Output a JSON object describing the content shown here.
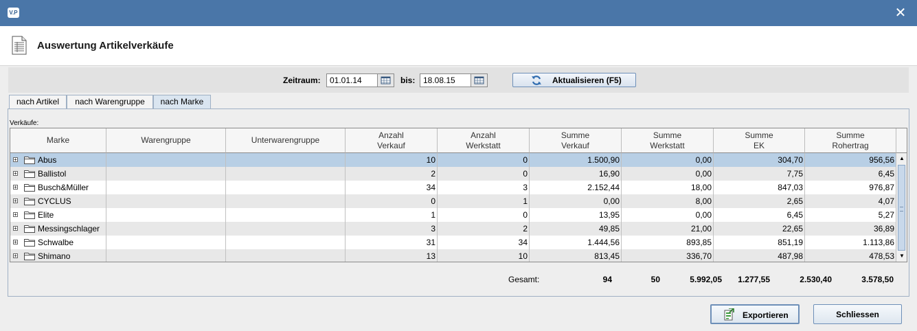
{
  "window": {
    "app_icon_text": "V.P"
  },
  "header": {
    "title": "Auswertung Artikelverkäufe"
  },
  "filter": {
    "zeitraum_label": "Zeitraum:",
    "from_value": "01.01.14",
    "bis_label": "bis:",
    "to_value": "18.08.15",
    "refresh_label": "Aktualisieren (F5)"
  },
  "tabs": [
    {
      "label": "nach Artikel",
      "active": false
    },
    {
      "label": "nach Warengruppe",
      "active": false
    },
    {
      "label": "nach Marke",
      "active": true
    }
  ],
  "section_label": "Verkäufe:",
  "table": {
    "columns": [
      "Marke",
      "Warengruppe",
      "Unterwarengruppe",
      "Anzahl\nVerkauf",
      "Anzahl\nWerkstatt",
      "Summe\nVerkauf",
      "Summe\nWerkstatt",
      "Summe\nEK",
      "Summe\nRohertrag"
    ],
    "rows": [
      {
        "marke": "Abus",
        "warengruppe": "",
        "unterwarengruppe": "",
        "anz_verkauf": "10",
        "anz_werkstatt": "0",
        "sum_verkauf": "1.500,90",
        "sum_werkstatt": "0,00",
        "sum_ek": "304,70",
        "sum_rohertrag": "956,56",
        "selected": true
      },
      {
        "marke": "Ballistol",
        "warengruppe": "",
        "unterwarengruppe": "",
        "anz_verkauf": "2",
        "anz_werkstatt": "0",
        "sum_verkauf": "16,90",
        "sum_werkstatt": "0,00",
        "sum_ek": "7,75",
        "sum_rohertrag": "6,45",
        "selected": false
      },
      {
        "marke": "Busch&Müller",
        "warengruppe": "",
        "unterwarengruppe": "",
        "anz_verkauf": "34",
        "anz_werkstatt": "3",
        "sum_verkauf": "2.152,44",
        "sum_werkstatt": "18,00",
        "sum_ek": "847,03",
        "sum_rohertrag": "976,87",
        "selected": false
      },
      {
        "marke": "CYCLUS",
        "warengruppe": "",
        "unterwarengruppe": "",
        "anz_verkauf": "0",
        "anz_werkstatt": "1",
        "sum_verkauf": "0,00",
        "sum_werkstatt": "8,00",
        "sum_ek": "2,65",
        "sum_rohertrag": "4,07",
        "selected": false
      },
      {
        "marke": "Elite",
        "warengruppe": "",
        "unterwarengruppe": "",
        "anz_verkauf": "1",
        "anz_werkstatt": "0",
        "sum_verkauf": "13,95",
        "sum_werkstatt": "0,00",
        "sum_ek": "6,45",
        "sum_rohertrag": "5,27",
        "selected": false
      },
      {
        "marke": "Messingschlager",
        "warengruppe": "",
        "unterwarengruppe": "",
        "anz_verkauf": "3",
        "anz_werkstatt": "2",
        "sum_verkauf": "49,85",
        "sum_werkstatt": "21,00",
        "sum_ek": "22,65",
        "sum_rohertrag": "36,89",
        "selected": false
      },
      {
        "marke": "Schwalbe",
        "warengruppe": "",
        "unterwarengruppe": "",
        "anz_verkauf": "31",
        "anz_werkstatt": "34",
        "sum_verkauf": "1.444,56",
        "sum_werkstatt": "893,85",
        "sum_ek": "851,19",
        "sum_rohertrag": "1.113,86",
        "selected": false
      },
      {
        "marke": "Shimano",
        "warengruppe": "",
        "unterwarengruppe": "",
        "anz_verkauf": "13",
        "anz_werkstatt": "10",
        "sum_verkauf": "813,45",
        "sum_werkstatt": "336,70",
        "sum_ek": "487,98",
        "sum_rohertrag": "478,53",
        "selected": false
      }
    ]
  },
  "totals": {
    "label": "Gesamt:",
    "anz_verkauf": "94",
    "anz_werkstatt": "50",
    "sum_verkauf": "5.992,05",
    "sum_werkstatt": "1.277,55",
    "sum_ek": "2.530,40",
    "sum_rohertrag": "3.578,50"
  },
  "buttons": {
    "export_label": "Exportieren",
    "close_label": "Schliessen"
  },
  "icons": {
    "app": "app-logo-icon",
    "close": "close-icon",
    "document": "document-list-icon",
    "calendar": "calendar-icon",
    "refresh": "refresh-icon",
    "expand": "expand-plus-icon",
    "folder": "folder-icon",
    "export": "export-sheet-icon"
  },
  "colors": {
    "titlebar": "#4a76a8",
    "selection": "#b8cfe5",
    "alt_row": "#e8e8e8"
  }
}
